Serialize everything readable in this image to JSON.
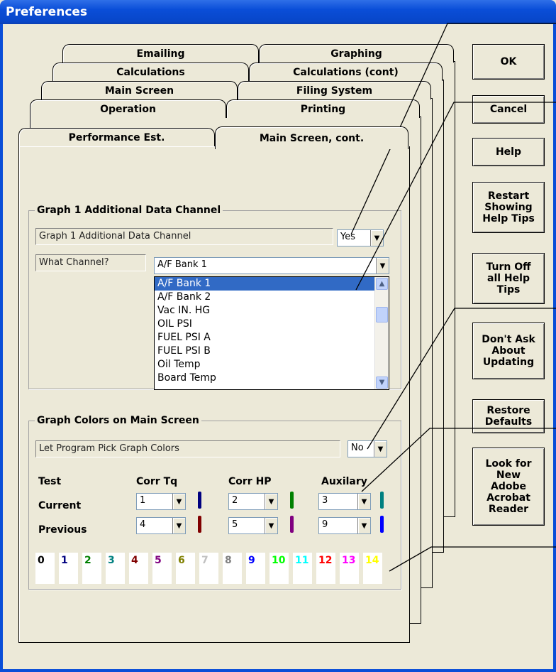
{
  "window": {
    "title": "Preferences"
  },
  "tabs": {
    "emailing": "Emailing",
    "graphing": "Graphing",
    "calculations": "Calculations",
    "calculations_cont": "Calculations (cont)",
    "main_screen": "Main Screen",
    "filing_system": "Filing System",
    "operation": "Operation",
    "printing": "Printing",
    "performance_est": "Performance Est.",
    "main_screen_cont": "Main Screen, cont."
  },
  "buttons": {
    "ok": "OK",
    "cancel": "Cancel",
    "help": "Help",
    "restart_tips": "Restart\nShowing\nHelp Tips",
    "turn_off_tips": "Turn Off\nall Help\nTips",
    "dont_ask": "Don't Ask\nAbout\nUpdating",
    "restore": "Restore\nDefaults",
    "look_adobe": "Look for\nNew\nAdobe\nAcrobat\nReader"
  },
  "graph1": {
    "group_title": "Graph 1 Additional Data Channel",
    "field_label": "Graph 1 Additional Data Channel",
    "field_value": "Yes",
    "channel_label": "What Channel?",
    "channel_value": "A/F Bank 1",
    "channel_options": [
      "A/F Bank 1",
      "A/F Bank 2",
      "Vac IN. HG",
      "OIL PSI",
      "FUEL PSI A",
      "FUEL PSI B",
      "Oil Temp",
      "Board Temp"
    ],
    "selected_index": 0
  },
  "colors": {
    "group_title": "Graph Colors on Main Screen",
    "pick_label": "Let Program Pick Graph Colors",
    "pick_value": "No",
    "headers": {
      "test": "Test",
      "corr_tq": "Corr Tq",
      "corr_hp": "Corr HP",
      "auxilary": "Auxilary"
    },
    "rows": {
      "current": "Current",
      "previous": "Previous"
    },
    "current": {
      "corr_tq": "1",
      "corr_hp": "2",
      "auxilary": "3"
    },
    "previous": {
      "corr_tq": "4",
      "corr_hp": "5",
      "auxilary": "9"
    },
    "swatch_colors": {
      "current_tq": "#000080",
      "current_hp": "#008000",
      "current_aux": "#008080",
      "previous_tq": "#800000",
      "previous_hp": "#800080",
      "previous_aux": "#0000FF"
    },
    "palette": [
      {
        "n": "0",
        "color": "#000000"
      },
      {
        "n": "1",
        "color": "#000080"
      },
      {
        "n": "2",
        "color": "#008000"
      },
      {
        "n": "3",
        "color": "#008080"
      },
      {
        "n": "4",
        "color": "#800000"
      },
      {
        "n": "5",
        "color": "#800080"
      },
      {
        "n": "6",
        "color": "#808000"
      },
      {
        "n": "7",
        "color": "#C0C0C0"
      },
      {
        "n": "8",
        "color": "#808080"
      },
      {
        "n": "9",
        "color": "#0000FF"
      },
      {
        "n": "10",
        "color": "#00FF00"
      },
      {
        "n": "11",
        "color": "#00FFFF"
      },
      {
        "n": "12",
        "color": "#FF0000"
      },
      {
        "n": "13",
        "color": "#FF00FF"
      },
      {
        "n": "14",
        "color": "#FFFF00"
      }
    ]
  }
}
